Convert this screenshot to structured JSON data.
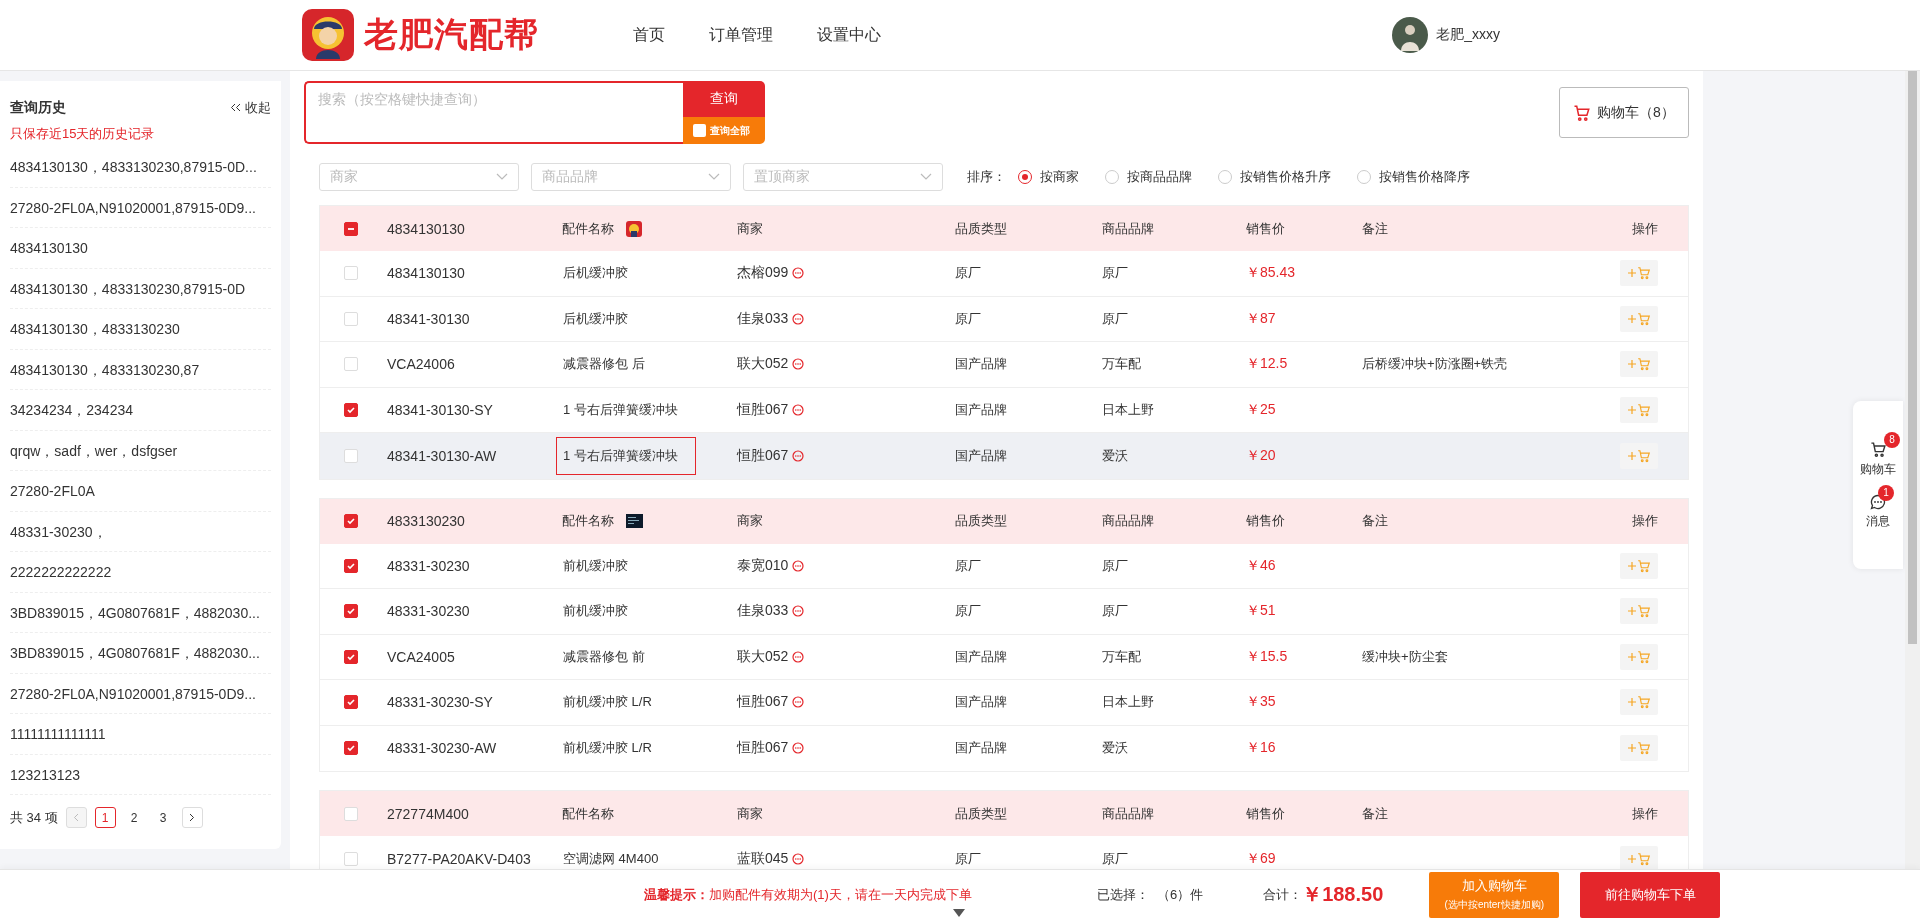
{
  "header": {
    "brand": "老肥汽配帮",
    "nav": [
      {
        "label": "首页",
        "selected": false
      },
      {
        "label": "订单管理",
        "selected": false
      },
      {
        "label": "设置中心",
        "selected": false
      }
    ],
    "user": "老肥_xxxy"
  },
  "sidebar": {
    "title": "查询历史",
    "collapse": "收起",
    "notice": "只保存近15天的历史记录",
    "items": [
      "4834130130，4833130230,87915-0D...",
      "27280-2FL0A,N91020001,87915-0D9...",
      "4834130130",
      "4834130130，4833130230,87915-0D",
      "4834130130，4833130230",
      "4834130130，4833130230,87",
      "34234234，234234",
      "qrqw，sadf，wer，dsfgser",
      "27280-2FL0A",
      "48331-30230，",
      "2222222222222",
      "3BD839015，4G0807681F，4882030...",
      "3BD839015，4G0807681F，4882030...",
      "27280-2FL0A,N91020001,87915-0D9...",
      "11111111111111",
      "123213123"
    ],
    "pagination": {
      "total": "共 34 项",
      "pages": [
        {
          "label": "1",
          "selected": true
        },
        {
          "label": "2",
          "selected": false
        },
        {
          "label": "3",
          "selected": false
        }
      ]
    }
  },
  "search": {
    "placeholder": "搜索（按空格键快捷查询）",
    "button": "查询",
    "query_all": {
      "label": "查询全部",
      "checked": false
    }
  },
  "cart_button": "购物车（8）",
  "filters": [
    {
      "placeholder": "商家"
    },
    {
      "placeholder": "商品品牌"
    },
    {
      "placeholder": "置顶商家"
    }
  ],
  "sort": {
    "label": "排序：",
    "options": [
      {
        "label": "按商家",
        "selected": true
      },
      {
        "label": "按商品品牌",
        "selected": false
      },
      {
        "label": "按销售价格升序",
        "selected": false
      },
      {
        "label": "按销售价格降序",
        "selected": false
      }
    ]
  },
  "groups": [
    {
      "part_no": "4834130130",
      "checked": false,
      "indeterminate": true,
      "thumbnail": true,
      "columns": [
        "配件名称",
        "商家",
        "品质类型",
        "商品品牌",
        "销售价",
        "备注",
        "操作"
      ],
      "rows": [
        {
          "part_no": "4834130130",
          "name": "后机缓冲胶",
          "merchant": "杰榕099",
          "quality": "原厂",
          "brand": "原厂",
          "price": "￥85.43",
          "note": "",
          "checked": false,
          "hovered": false,
          "name_focused": false
        },
        {
          "part_no": "48341-30130",
          "name": "后机缓冲胶",
          "merchant": "佳泉033",
          "quality": "原厂",
          "brand": "原厂",
          "price": "￥87",
          "note": "",
          "checked": false,
          "hovered": false,
          "name_focused": false
        },
        {
          "part_no": "VCA24006",
          "name": "减震器修包 后",
          "merchant": "联大052",
          "quality": "国产品牌",
          "brand": "万车配",
          "price": "￥12.5",
          "note": "后桥缓冲块+防涨圈+铁壳",
          "checked": false,
          "hovered": false,
          "name_focused": false
        },
        {
          "part_no": "48341-30130-SY",
          "name": "1 号右后弹簧缓冲块",
          "merchant": "恒胜067",
          "quality": "国产品牌",
          "brand": "日本上野",
          "price": "￥25",
          "note": "",
          "checked": true,
          "hovered": false,
          "name_focused": false
        },
        {
          "part_no": "48341-30130-AW",
          "name": "1 号右后弹簧缓冲块",
          "merchant": "恒胜067",
          "quality": "国产品牌",
          "brand": "爱沃",
          "price": "￥20",
          "note": "",
          "checked": false,
          "hovered": true,
          "name_focused": true
        }
      ]
    },
    {
      "part_no": "4833130230",
      "checked": true,
      "thumbnail": true,
      "columns": [
        "配件名称",
        "商家",
        "品质类型",
        "商品品牌",
        "销售价",
        "备注",
        "操作"
      ],
      "rows": [
        {
          "part_no": "48331-30230",
          "name": "前机缓冲胶",
          "merchant": "泰宽010",
          "quality": "原厂",
          "brand": "原厂",
          "price": "￥46",
          "note": "",
          "checked": true,
          "hovered": false,
          "name_focused": false
        },
        {
          "part_no": "48331-30230",
          "name": "前机缓冲胶",
          "merchant": "佳泉033",
          "quality": "原厂",
          "brand": "原厂",
          "price": "￥51",
          "note": "",
          "checked": true,
          "hovered": false,
          "name_focused": false
        },
        {
          "part_no": "VCA24005",
          "name": "减震器修包 前",
          "merchant": "联大052",
          "quality": "国产品牌",
          "brand": "万车配",
          "price": "￥15.5",
          "note": "缓冲块+防尘套",
          "checked": true,
          "hovered": false,
          "name_focused": false
        },
        {
          "part_no": "48331-30230-SY",
          "name": "前机缓冲胶 L/R",
          "merchant": "恒胜067",
          "quality": "国产品牌",
          "brand": "日本上野",
          "price": "￥35",
          "note": "",
          "checked": true,
          "hovered": false,
          "name_focused": false
        },
        {
          "part_no": "48331-30230-AW",
          "name": "前机缓冲胶 L/R",
          "merchant": "恒胜067",
          "quality": "国产品牌",
          "brand": "爱沃",
          "price": "￥16",
          "note": "",
          "checked": true,
          "hovered": false,
          "name_focused": false
        }
      ]
    },
    {
      "part_no": "272774M400",
      "checked": false,
      "indeterminate": false,
      "thumbnail": false,
      "columns": [
        "配件名称",
        "商家",
        "品质类型",
        "商品品牌",
        "销售价",
        "备注",
        "操作"
      ],
      "rows": [
        {
          "part_no": "B7277-PA20AKV-D403",
          "name": "空调滤网 4M400",
          "merchant": "蓝联045",
          "quality": "原厂",
          "brand": "原厂",
          "price": "￥69",
          "note": "",
          "checked": false,
          "hovered": false,
          "name_focused": false
        }
      ]
    }
  ],
  "side_widget": [
    {
      "kind": "cart",
      "label": "购物车",
      "badge": "8"
    },
    {
      "kind": "message",
      "label": "消息",
      "badge": "1"
    }
  ],
  "footer": {
    "hint": "**温馨提示：**加购配件有效期为(1)天，请在一天内完成下单",
    "selected_label": "已选择：",
    "selected_count": "（6）件",
    "total_label": "合计：",
    "total": "￥188.50",
    "add_button": "加入购物车",
    "add_hint": "(选中按enter快捷加购)",
    "order_button": "前往购物车下单"
  }
}
